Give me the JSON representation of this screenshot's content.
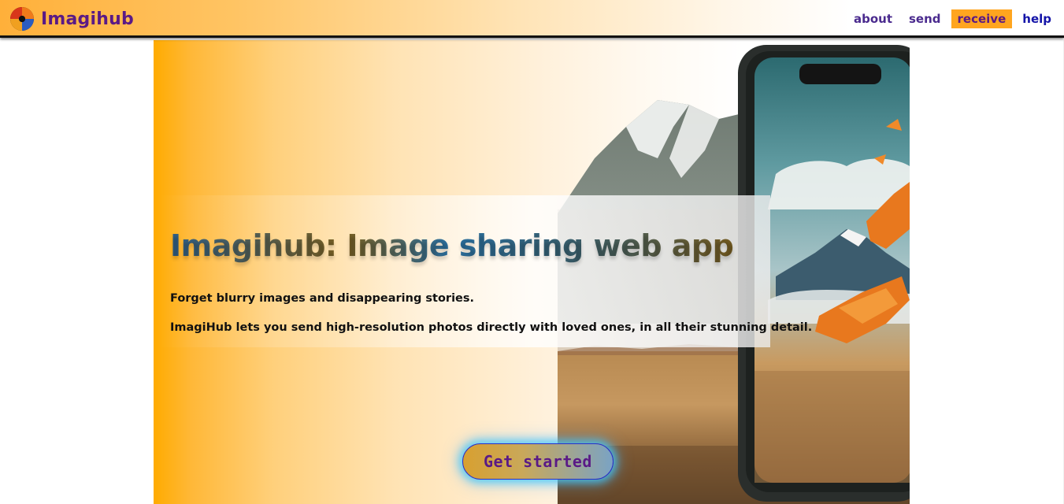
{
  "app": {
    "name": "Imagihub",
    "logo_icon": "aperture-swirl-icon"
  },
  "nav": {
    "items": [
      {
        "label": "about",
        "state": "normal"
      },
      {
        "label": "send",
        "state": "normal"
      },
      {
        "label": "receive",
        "state": "active"
      },
      {
        "label": "help",
        "state": "plain"
      }
    ]
  },
  "hero": {
    "title": "Imagihub: Image sharing web app",
    "line1": "Forget blurry images and disappearing stories.",
    "line2": "ImagiHub lets you send high-resolution photos directly with loved ones, in all their stunning detail.",
    "cta_label": "Get started",
    "background_image": "mountain-landscape-with-smartphone"
  },
  "colors": {
    "brand": "#5a1a86",
    "accent": "#ffa51f",
    "link": "#1414a8"
  }
}
